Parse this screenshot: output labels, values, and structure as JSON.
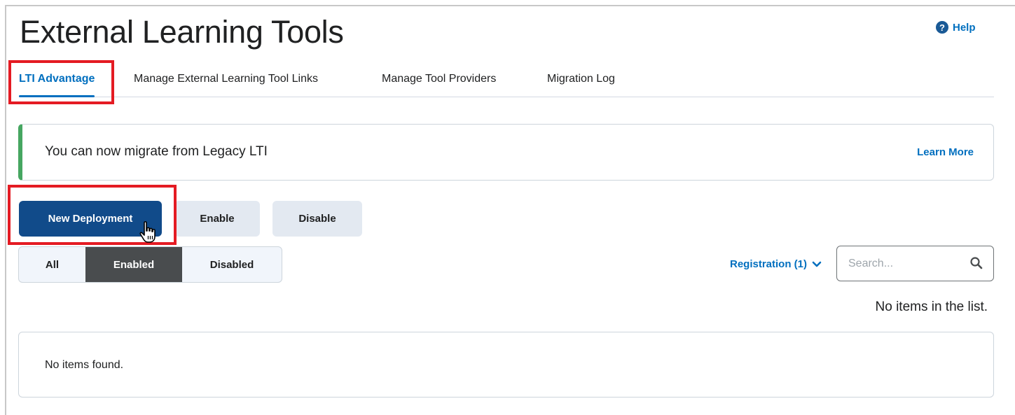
{
  "page": {
    "title": "External Learning Tools",
    "help_label": "Help"
  },
  "tabs": [
    {
      "label": "LTI Advantage",
      "active": true
    },
    {
      "label": "Manage External Learning Tool Links",
      "active": false
    },
    {
      "label": "Manage Tool Providers",
      "active": false
    },
    {
      "label": "Migration Log",
      "active": false
    }
  ],
  "alert": {
    "message": "You can now migrate from Legacy LTI",
    "link_label": "Learn More",
    "accent_color": "#46a661"
  },
  "actions": {
    "new_deployment_label": "New Deployment",
    "enable_label": "Enable",
    "disable_label": "Disable"
  },
  "status_filter": {
    "options": [
      "All",
      "Enabled",
      "Disabled"
    ],
    "selected": "Enabled"
  },
  "registration_filter": {
    "label": "Registration (1)"
  },
  "search": {
    "placeholder": "Search...",
    "value": ""
  },
  "list": {
    "count_text": "No items in the list.",
    "empty_text": "No items found."
  },
  "colors": {
    "primary": "#114b8a",
    "link": "#006fbf",
    "highlight": "#e41b23"
  },
  "icons": {
    "help": "help-circle-icon",
    "chevron": "chevron-down-icon",
    "search": "magnifier-icon",
    "cursor": "hand-pointer-cursor-icon"
  }
}
